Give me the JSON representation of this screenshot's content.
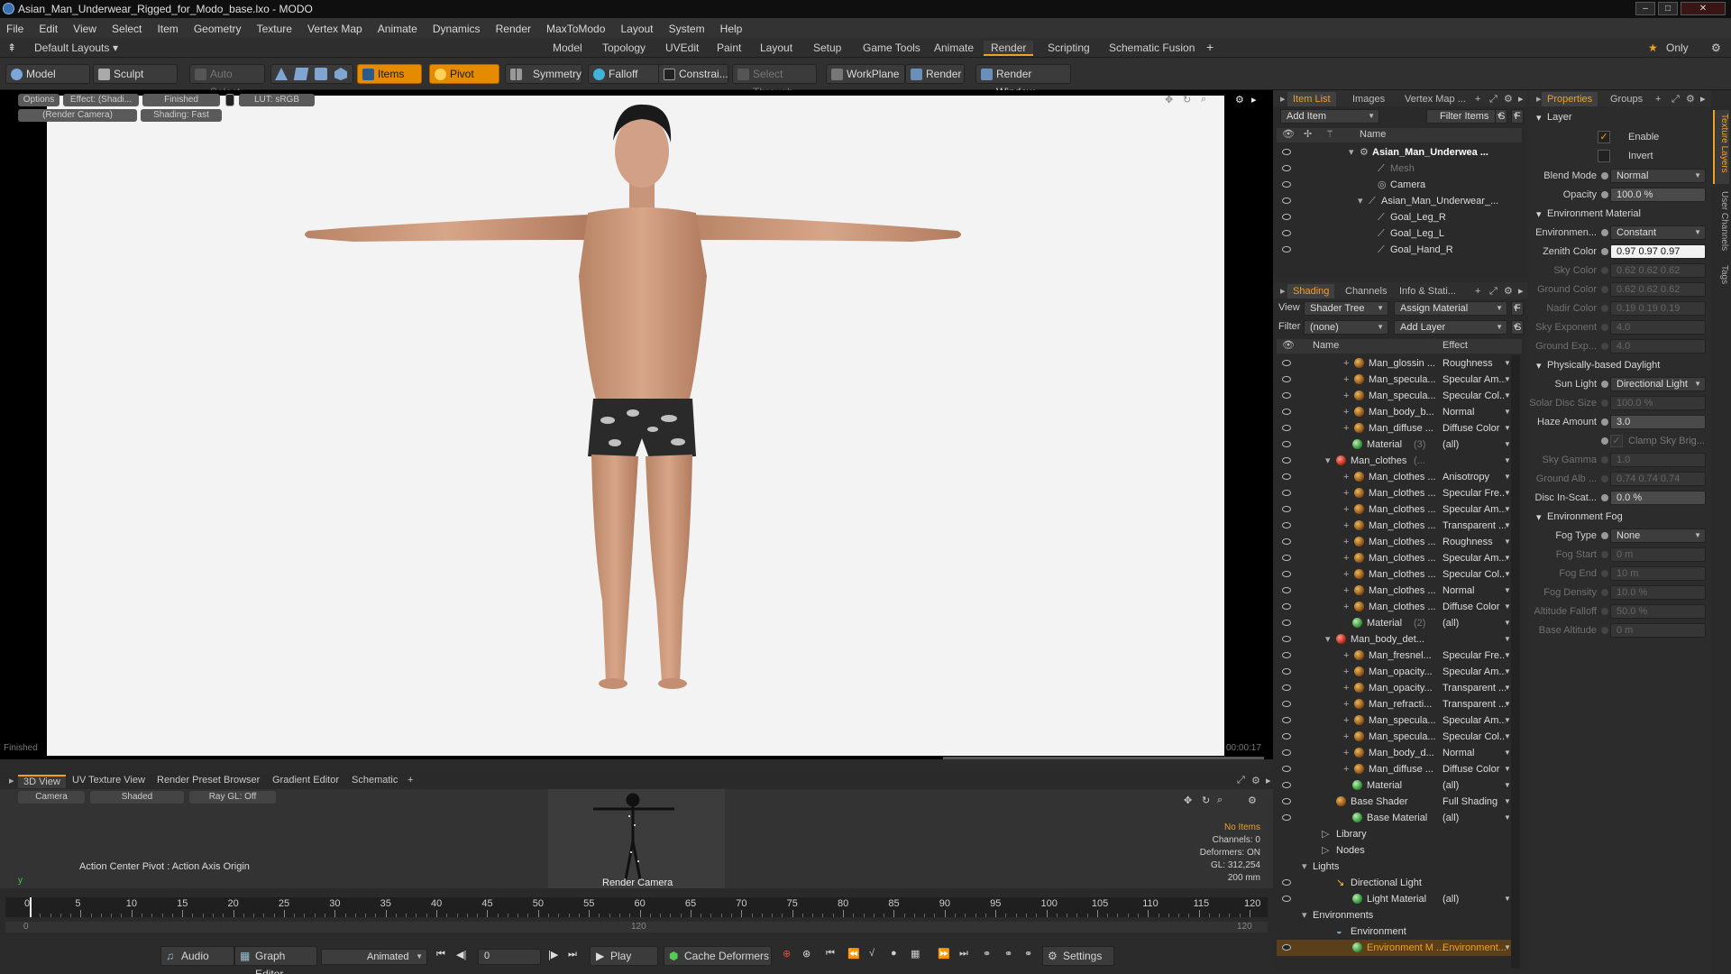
{
  "window": {
    "title": "Asian_Man_Underwear_Rigged_for_Modo_base.lxo - MODO",
    "min": "–",
    "max": "□",
    "close": "✕"
  },
  "menu": [
    "File",
    "Edit",
    "View",
    "Select",
    "Item",
    "Geometry",
    "Texture",
    "Vertex Map",
    "Animate",
    "Dynamics",
    "Render",
    "MaxToModo",
    "Layout",
    "System",
    "Help"
  ],
  "layouts": {
    "default": "Default Layouts",
    "tabs": [
      "Model",
      "Topology",
      "UVEdit",
      "Paint",
      "Layout",
      "Setup",
      "Game Tools",
      "Animate",
      "Render",
      "Scripting",
      "Schematic Fusion"
    ],
    "active": "Render",
    "plus": "+",
    "only": "Only"
  },
  "toolbar": {
    "model": "Model",
    "sculpt": "Sculpt",
    "auto_select": "Auto Select",
    "items": "Items",
    "pivot": "Pivot",
    "symmetry": "Symmetry",
    "falloff": "Falloff",
    "constraint": "Constrai...",
    "select_through": "Select Through",
    "workplane": "WorkPlane",
    "render": "Render",
    "render_window": "Render Window"
  },
  "viewport": {
    "options": "Options",
    "effect": "Effect: (Shadi...",
    "finished_badge": "Finished",
    "lut": "LUT: sRGB",
    "camera_badge": "(Render Camera)",
    "shading_badge": "Shading: Fast",
    "status_left": "Finished",
    "timer": "00:00:17"
  },
  "bottom": {
    "tabs": [
      "3D View",
      "UV Texture View",
      "Render Preset Browser",
      "Gradient Editor",
      "Schematic"
    ],
    "plus": "+",
    "camera": "Camera",
    "shaded": "Shaded",
    "raygl": "Ray GL: Off",
    "action_center": "Action Center Pivot : Action Axis Origin",
    "render_camera": "Render Camera",
    "info": [
      "No Items",
      "Channels: 0",
      "Deformers: ON",
      "GL: 312,254",
      "200 mm"
    ]
  },
  "timeline": {
    "ticks": [
      0,
      5,
      10,
      15,
      20,
      25,
      30,
      35,
      40,
      45,
      50,
      55,
      60,
      65,
      70,
      75,
      80,
      85,
      90,
      95,
      100,
      105,
      110,
      115,
      120
    ],
    "sub_start": "0",
    "sub_mid": "120",
    "sub_end": "120"
  },
  "transport": {
    "audio": "Audio",
    "graph_editor": "Graph Editor",
    "animated": "Animated",
    "frame": "0",
    "play": "Play",
    "cache": "Cache Deformers",
    "settings": "Settings"
  },
  "itemlist": {
    "tabs": [
      "Item List",
      "Images",
      "Vertex Map ..."
    ],
    "add_item": "Add Item",
    "filter_items": "Filter Items",
    "s": "S",
    "f": "F",
    "col_name": "Name",
    "items": [
      {
        "name": "Asian_Man_Underwea ...",
        "indent": 0
      },
      {
        "name": "Mesh",
        "indent": 2
      },
      {
        "name": "Camera",
        "indent": 2
      },
      {
        "name": "Asian_Man_Underwear_...",
        "indent": 1
      },
      {
        "name": "Goal_Leg_R",
        "indent": 2
      },
      {
        "name": "Goal_Leg_L",
        "indent": 2
      },
      {
        "name": "Goal_Hand_R",
        "indent": 2
      }
    ]
  },
  "shading": {
    "tabs": [
      "Shading",
      "Channels",
      "Info & Stati..."
    ],
    "view_label": "View",
    "view_value": "Shader Tree",
    "assign_material": "Assign Material",
    "f": "F",
    "filter_label": "Filter",
    "filter_value": "(none)",
    "add_layer": "Add Layer",
    "s": "S",
    "col_name": "Name",
    "col_effect": "Effect",
    "rows": [
      {
        "name": "Man_glossin ...",
        "effect": "Roughness",
        "type": "tex"
      },
      {
        "name": "Man_specula...",
        "effect": "Specular Am...",
        "type": "tex"
      },
      {
        "name": "Man_specula...",
        "effect": "Specular Col...",
        "type": "tex"
      },
      {
        "name": "Man_body_b...",
        "effect": "Normal",
        "type": "tex"
      },
      {
        "name": "Man_diffuse ...",
        "effect": "Diffuse Color",
        "type": "tex"
      },
      {
        "name": "Material",
        "suffix": "(3)",
        "effect": "(all)",
        "type": "mat"
      },
      {
        "name": "Man_clothes",
        "suffix": "(...",
        "effect": "",
        "type": "mask"
      },
      {
        "name": "Man_clothes ...",
        "effect": "Anisotropy",
        "type": "tex"
      },
      {
        "name": "Man_clothes ...",
        "effect": "Specular Fre...",
        "type": "tex"
      },
      {
        "name": "Man_clothes ...",
        "effect": "Specular Am...",
        "type": "tex"
      },
      {
        "name": "Man_clothes ...",
        "effect": "Transparent ...",
        "type": "tex"
      },
      {
        "name": "Man_clothes ...",
        "effect": "Roughness",
        "type": "tex"
      },
      {
        "name": "Man_clothes ...",
        "effect": "Specular Am...",
        "type": "tex"
      },
      {
        "name": "Man_clothes ...",
        "effect": "Specular Col...",
        "type": "tex"
      },
      {
        "name": "Man_clothes ...",
        "effect": "Normal",
        "type": "tex"
      },
      {
        "name": "Man_clothes ...",
        "effect": "Diffuse Color",
        "type": "tex"
      },
      {
        "name": "Material",
        "suffix": "(2)",
        "effect": "(all)",
        "type": "mat"
      },
      {
        "name": "Man_body_det...",
        "effect": "",
        "type": "mask"
      },
      {
        "name": "Man_fresnel...",
        "effect": "Specular Fre...",
        "type": "tex"
      },
      {
        "name": "Man_opacity...",
        "effect": "Specular Am...",
        "type": "tex"
      },
      {
        "name": "Man_opacity...",
        "effect": "Transparent ...",
        "type": "tex"
      },
      {
        "name": "Man_refracti...",
        "effect": "Transparent ...",
        "type": "tex"
      },
      {
        "name": "Man_specula...",
        "effect": "Specular Am...",
        "type": "tex"
      },
      {
        "name": "Man_specula...",
        "effect": "Specular Col...",
        "type": "tex"
      },
      {
        "name": "Man_body_d...",
        "effect": "Normal",
        "type": "tex"
      },
      {
        "name": "Man_diffuse ...",
        "effect": "Diffuse Color",
        "type": "tex"
      },
      {
        "name": "Material",
        "suffix": "",
        "effect": "(all)",
        "type": "mat"
      },
      {
        "name": "Base Shader",
        "effect": "Full Shading",
        "type": "shader"
      },
      {
        "name": "Base Material",
        "effect": "(all)",
        "type": "mat"
      },
      {
        "name": "Library",
        "effect": "",
        "type": "folder"
      },
      {
        "name": "Nodes",
        "effect": "",
        "type": "folder"
      },
      {
        "name": "Lights",
        "effect": "",
        "type": "group"
      },
      {
        "name": "Directional Light",
        "effect": "",
        "type": "light"
      },
      {
        "name": "Light Material",
        "effect": "(all)",
        "type": "mat"
      },
      {
        "name": "Environments",
        "effect": "",
        "type": "group"
      },
      {
        "name": "Environment",
        "effect": "",
        "type": "env"
      },
      {
        "name": "Environment M ...",
        "effect": "Environment...",
        "type": "mat"
      }
    ]
  },
  "properties": {
    "tabs": [
      "Properties",
      "Groups"
    ],
    "side_tabs": [
      "Texture Layers",
      "User Channels",
      "Tags"
    ],
    "layer": "Layer",
    "enable": "Enable",
    "invert": "Invert",
    "fields": [
      {
        "label": "Blend Mode",
        "value": "Normal",
        "kind": "dd"
      },
      {
        "label": "Opacity",
        "value": "100.0 %",
        "kind": "val"
      },
      {
        "section": "Environment Material"
      },
      {
        "label": "Environmen...",
        "value": "Constant",
        "kind": "dd"
      },
      {
        "label": "Zenith Color",
        "value": "0.97 0.97 0.97",
        "kind": "white"
      },
      {
        "label": "Sky Color",
        "value": "0.62 0.62 0.62",
        "kind": "dim"
      },
      {
        "label": "Ground Color",
        "value": "0.62 0.62 0.62",
        "kind": "dim"
      },
      {
        "label": "Nadir Color",
        "value": "0.19 0.19 0.19",
        "kind": "dim"
      },
      {
        "label": "Sky Exponent",
        "value": "4.0",
        "kind": "dim"
      },
      {
        "label": "Ground Exp...",
        "value": "4.0",
        "kind": "dim"
      },
      {
        "section": "Physically-based Daylight"
      },
      {
        "label": "Sun Light",
        "value": "Directional Light",
        "kind": "dd"
      },
      {
        "label": "Solar Disc Size",
        "value": "100.0 %",
        "kind": "dim"
      },
      {
        "label": "Haze Amount",
        "value": "3.0",
        "kind": "val"
      },
      {
        "label": "",
        "value": "Clamp Sky Brig...",
        "kind": "check"
      },
      {
        "label": "Sky Gamma",
        "value": "1.0",
        "kind": "dim"
      },
      {
        "label": "Ground Alb ...",
        "value": "0.74 0.74 0.74",
        "kind": "dim"
      },
      {
        "label": "Disc In-Scat...",
        "value": "0.0 %",
        "kind": "val"
      },
      {
        "section": "Environment Fog"
      },
      {
        "label": "Fog Type",
        "value": "None",
        "kind": "dd"
      },
      {
        "label": "Fog Start",
        "value": "0 m",
        "kind": "dim"
      },
      {
        "label": "Fog End",
        "value": "10 m",
        "kind": "dim"
      },
      {
        "label": "Fog Density",
        "value": "10.0 %",
        "kind": "dim"
      },
      {
        "label": "Altitude Falloff",
        "value": "50.0 %",
        "kind": "dim"
      },
      {
        "label": "Base Altitude",
        "value": "0 m",
        "kind": "dim"
      }
    ]
  },
  "colors": {
    "accent": "#f0a020",
    "orange_button": "#e68a00",
    "viewport_bg": "#f3f3f3",
    "panel": "#2b2b2b"
  }
}
